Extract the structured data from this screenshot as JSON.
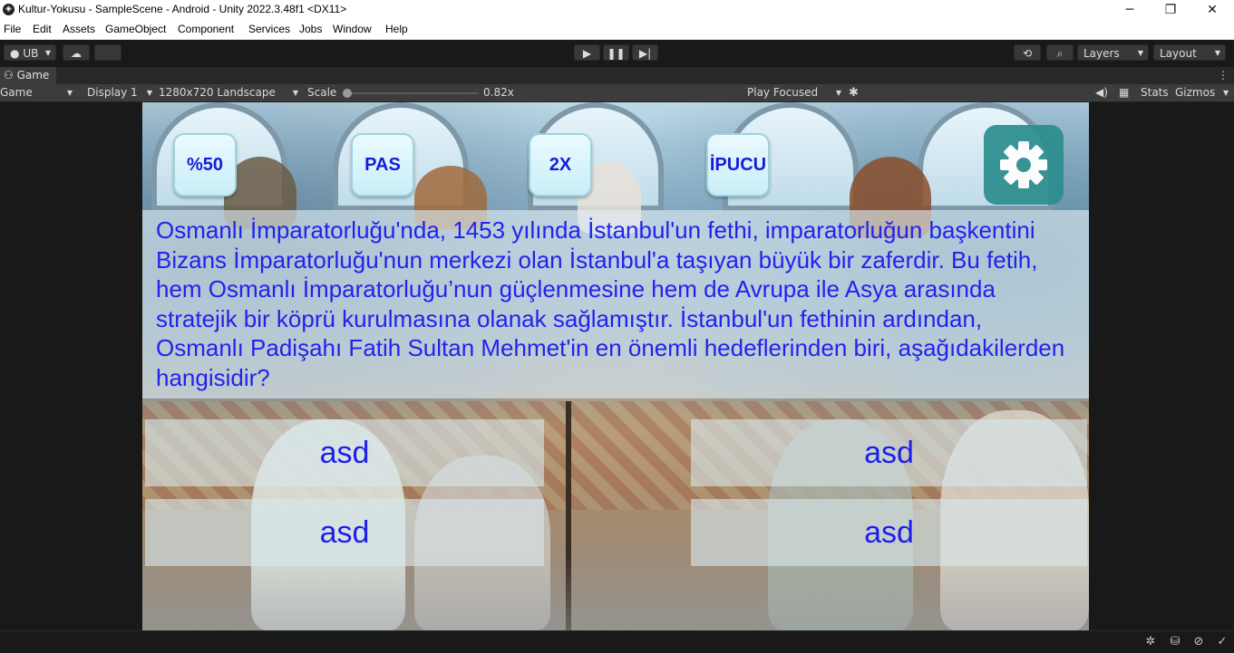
{
  "window": {
    "title": "Kultur-Yokusu - SampleScene - Android - Unity 2022.3.48f1 <DX11>",
    "minimize": "─",
    "restore": "❐",
    "close": "✕"
  },
  "menu": [
    "File",
    "Edit",
    "Assets",
    "GameObject",
    "Component",
    "Services",
    "Jobs",
    "Window",
    "Help"
  ],
  "toolbar": {
    "account": "UB",
    "layers_label": "Layers",
    "layout_label": "Layout"
  },
  "tab": {
    "label": "Game"
  },
  "game_toolbar": {
    "mode": "Game",
    "display": "Display 1",
    "resolution": "1280x720 Landscape",
    "scale_label": "Scale",
    "scale_value": "0.82x",
    "play_mode": "Play Focused",
    "stats": "Stats",
    "gizmos": "Gizmos"
  },
  "game": {
    "powerups": [
      "%50",
      "PAS",
      "2X",
      "İPUCU"
    ],
    "question": "Osmanlı İmparatorluğu'nda, 1453 yılında İstanbul'un fethi, imparatorluğun başkentini Bizans İmparatorluğu'nun merkezi olan İstanbul'a taşıyan büyük bir zaferdir. Bu fetih, hem Osmanlı İmparatorluğu’nun güçlenmesine hem de Avrupa ile Asya arasında stratejik bir köprü kurulmasına olanak sağlamıştır. İstanbul'un fethinin ardından, Osmanlı Padişahı Fatih Sultan Mehmet'in en önemli hedeflerinden biri, aşağıdakilerden hangisidir?",
    "answers": [
      "asd",
      "asd",
      "asd",
      "asd"
    ]
  },
  "colors": {
    "question_text": "#2222ee",
    "settings_bg": "#2d8e8e",
    "editor_bg": "#191919"
  }
}
